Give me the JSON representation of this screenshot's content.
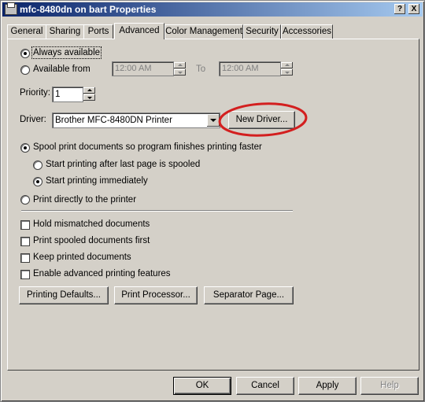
{
  "window": {
    "title": "mfc-8480dn on bart Properties",
    "help_label": "?",
    "close_label": "X"
  },
  "tabs": [
    {
      "label": "General"
    },
    {
      "label": "Sharing"
    },
    {
      "label": "Ports"
    },
    {
      "label": "Advanced"
    },
    {
      "label": "Color Management"
    },
    {
      "label": "Security"
    },
    {
      "label": "Accessories"
    }
  ],
  "availability": {
    "always_label": "Always available",
    "from_label": "Available from",
    "from_time": "12:00 AM",
    "to_label": "To",
    "to_time": "12:00 AM"
  },
  "priority": {
    "label": "Priority:",
    "value": "1"
  },
  "driver": {
    "label": "Driver:",
    "value": "Brother MFC-8480DN Printer",
    "new_driver_button": "New Driver..."
  },
  "spooling": {
    "spool_label": "Spool print documents so program finishes printing faster",
    "after_last_page_label": "Start printing after last page is spooled",
    "immediately_label": "Start printing immediately",
    "direct_label": "Print directly to the printer"
  },
  "options": {
    "hold_mismatched": "Hold mismatched documents",
    "spooled_first": "Print spooled documents first",
    "keep_printed": "Keep printed documents",
    "advanced_features": "Enable advanced printing features"
  },
  "panel_buttons": {
    "printing_defaults": "Printing Defaults...",
    "print_processor": "Print Processor...",
    "separator_page": "Separator Page..."
  },
  "dialog_buttons": {
    "ok": "OK",
    "cancel": "Cancel",
    "apply": "Apply",
    "help": "Help"
  },
  "colors": {
    "titlebar_start": "#0a246a",
    "titlebar_end": "#a6caf0",
    "dialog_face": "#d4d0c8",
    "annotation_circle": "#d31f1f"
  }
}
